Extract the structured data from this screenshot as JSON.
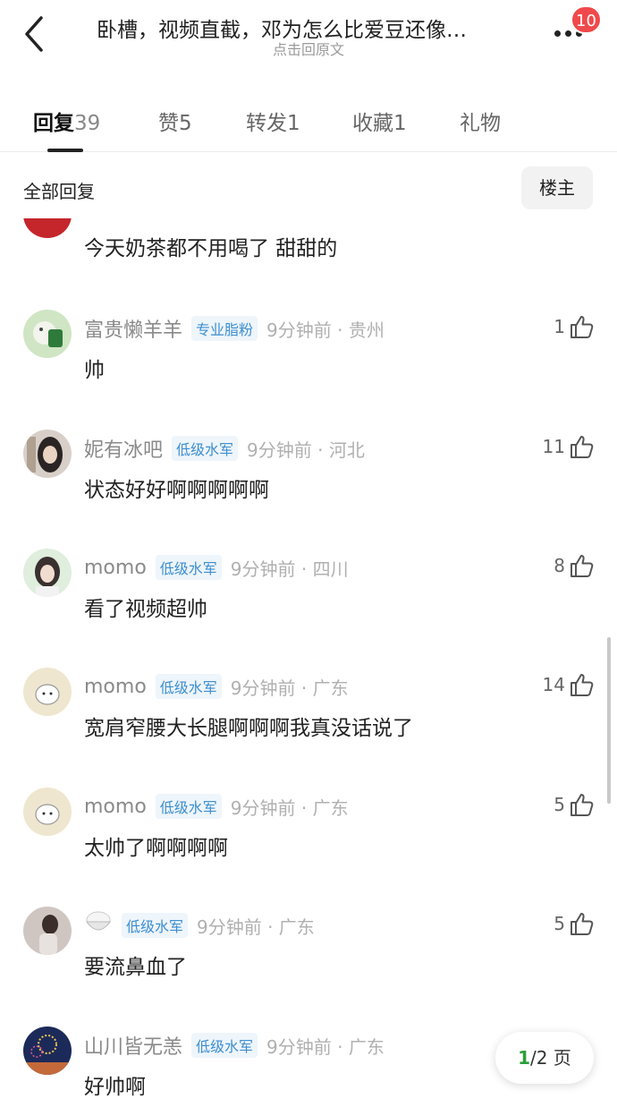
{
  "header": {
    "title": "卧槽，视频直截，邓为怎么比爱豆还像…",
    "subtitle": "点击回原文",
    "badge_count": "10"
  },
  "tabs": [
    {
      "label": "回复",
      "count": "39",
      "active": true
    },
    {
      "label": "赞",
      "count": "5",
      "active": false
    },
    {
      "label": "转发",
      "count": "1",
      "active": false
    },
    {
      "label": "收藏",
      "count": "1",
      "active": false
    },
    {
      "label": "礼物",
      "count": "",
      "active": false
    }
  ],
  "filter": {
    "label": "全部回复",
    "owner_button": "楼主"
  },
  "partial_comment": {
    "text": "今天奶茶都不用喝了  甜甜的"
  },
  "comments": [
    {
      "username": "富贵懒羊羊",
      "tag": "专业脂粉",
      "time": "9分钟前 · 贵州",
      "likes": "1",
      "text": "帅",
      "avatar": "green-cartoon-avatar"
    },
    {
      "username": "妮有冰吧",
      "tag": "低级水军",
      "time": "9分钟前 · 河北",
      "likes": "11",
      "text": "状态好好啊啊啊啊啊",
      "avatar": "girl-photo-avatar"
    },
    {
      "username": "momo",
      "tag": "低级水军",
      "time": "9分钟前 · 四川",
      "likes": "8",
      "text": "看了视频超帅",
      "avatar": "girl-green-avatar"
    },
    {
      "username": "momo",
      "tag": "低级水军",
      "time": "9分钟前 · 广东",
      "likes": "14",
      "text": "宽肩窄腰大长腿啊啊啊我真没话说了",
      "avatar": "cartoon-cat-avatar"
    },
    {
      "username": "momo",
      "tag": "低级水军",
      "time": "9分钟前 · 广东",
      "likes": "5",
      "text": "太帅了啊啊啊啊",
      "avatar": "cartoon-cat-avatar"
    },
    {
      "username": "",
      "tag": "低级水军",
      "time": "9分钟前 · 广东",
      "likes": "5",
      "text": "要流鼻血了",
      "avatar": "person-photo-avatar",
      "name_icon": "rice-bowl-icon"
    },
    {
      "username": "山川皆无恙",
      "tag": "低级水军",
      "time": "9分钟前 · 广东",
      "likes": "",
      "text": "好帅啊",
      "avatar": "fireworks-avatar"
    }
  ],
  "pager": {
    "current": "1",
    "rest": "/2 页"
  },
  "colors": {
    "accent_badge": "#f0494b",
    "tag_text": "#3d8fcf",
    "pager_current": "#2c9f3a"
  }
}
